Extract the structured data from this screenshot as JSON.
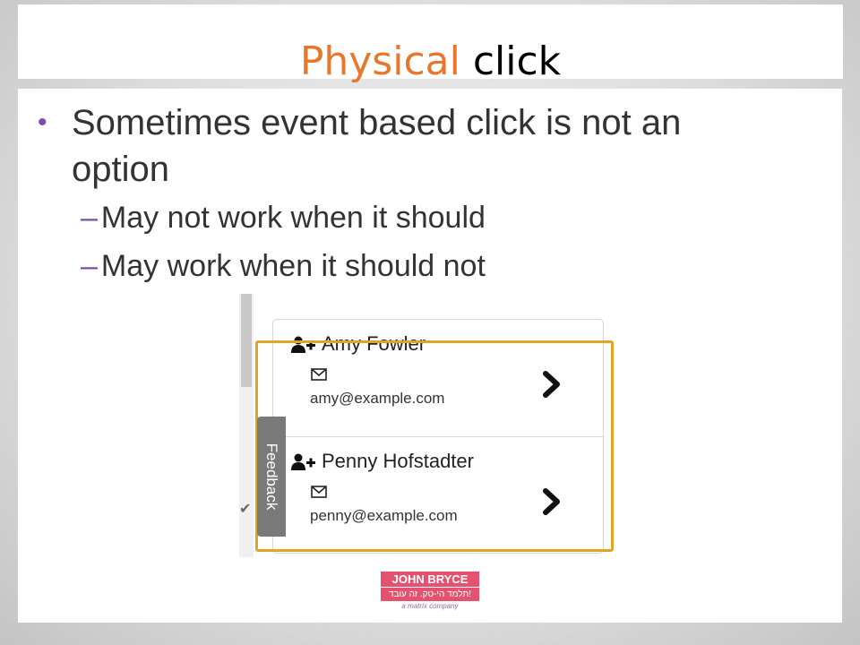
{
  "slide": {
    "title_accent": "Physical",
    "title_rest": "click",
    "bullet": "Sometimes event based click is not an option",
    "sub_bullets": [
      "May not work when it should",
      "May work when it should not"
    ],
    "colors": {
      "title_accent": "#e8772e",
      "bullet_marker": "#7a4fa6",
      "highlight_border": "#e0a526"
    }
  },
  "screenshot": {
    "contacts": [
      {
        "name": "Amy Fowler",
        "email": "amy@example.com",
        "icon": "add-user-icon"
      },
      {
        "name": "Penny Hofstadter",
        "email": "penny@example.com",
        "icon": "add-user-icon"
      }
    ],
    "feedback_label": "Feedback"
  },
  "logo": {
    "line1": "JOHN BRYCE",
    "line2": "תלמד הי-טק. זה עובד!",
    "line3": "a matrix company"
  }
}
